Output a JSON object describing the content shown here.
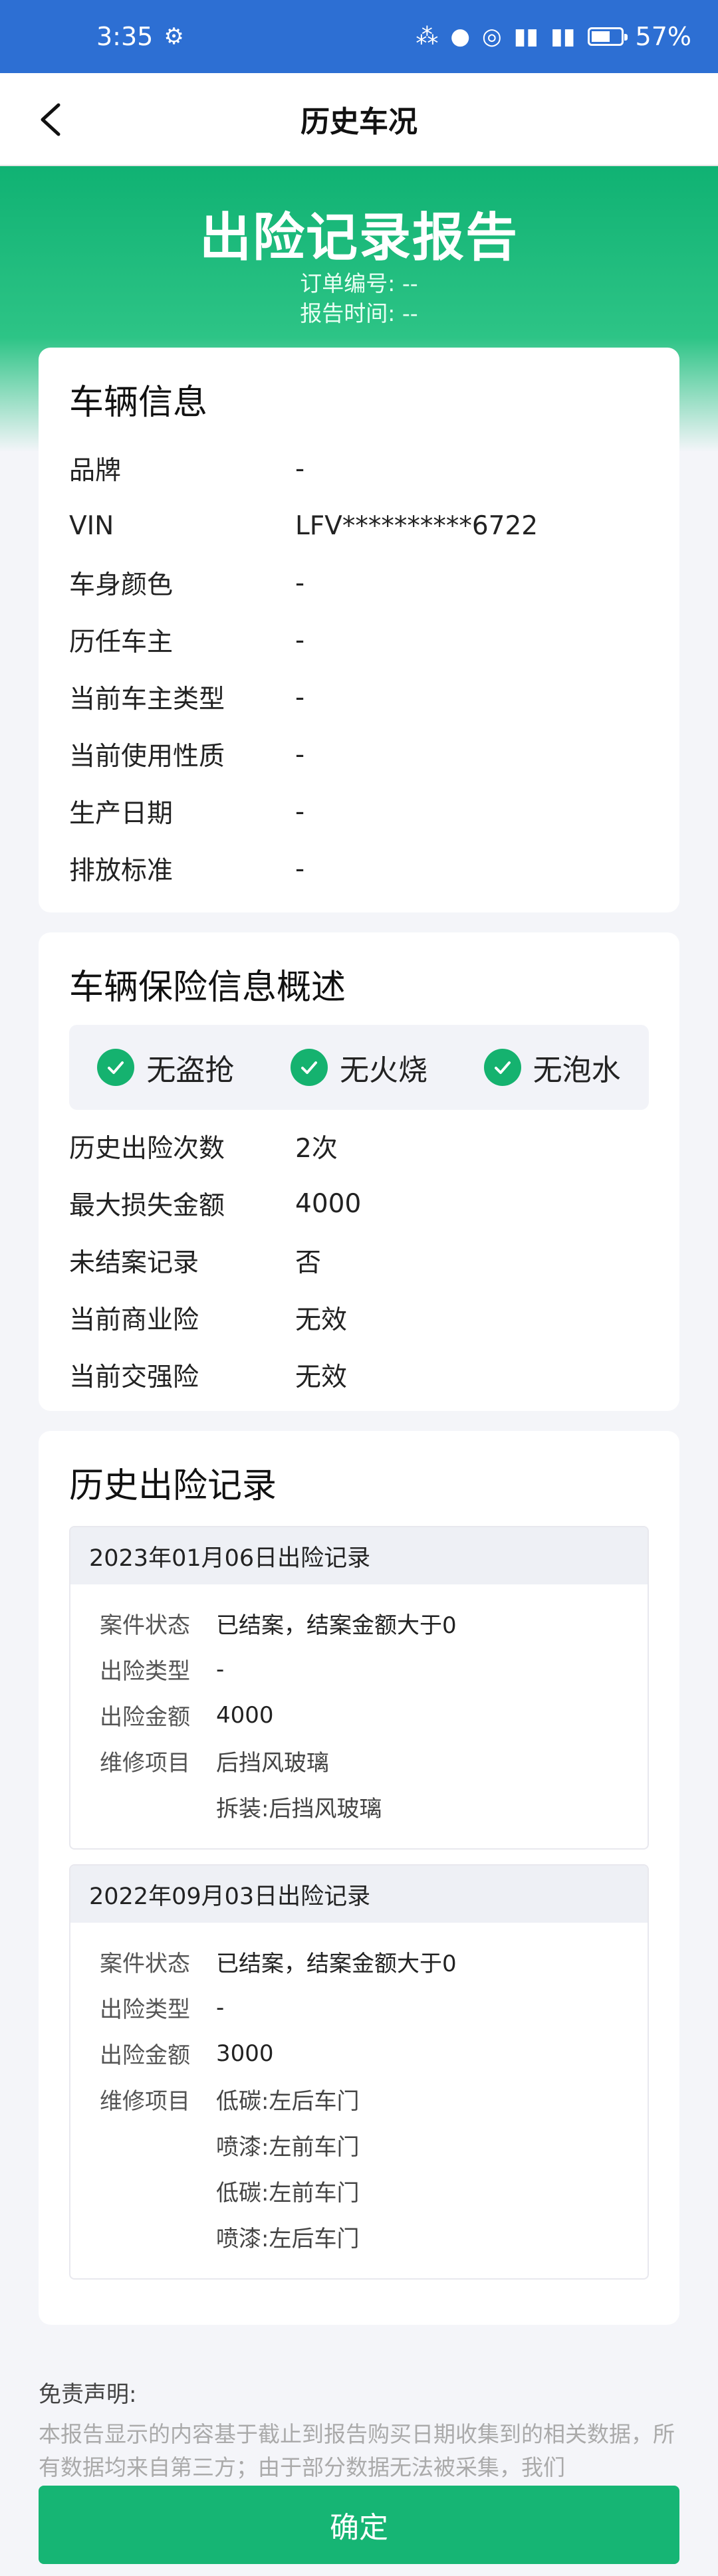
{
  "status_bar": {
    "time": "3:35",
    "battery": "57%"
  },
  "nav": {
    "title": "历史车况"
  },
  "hero": {
    "title": "出险记录报告",
    "order_label": "订单编号:",
    "order_value": "--",
    "report_time_label": "报告时间:",
    "report_time_value": "--"
  },
  "vehicle_info": {
    "title": "车辆信息",
    "rows": [
      {
        "label": "品牌",
        "value": "-"
      },
      {
        "label": "VIN",
        "value": "LFV**********6722"
      },
      {
        "label": "车身颜色",
        "value": "-"
      },
      {
        "label": "历任车主",
        "value": "-"
      },
      {
        "label": "当前车主类型",
        "value": "-"
      },
      {
        "label": "当前使用性质",
        "value": "-"
      },
      {
        "label": "生产日期",
        "value": "-"
      },
      {
        "label": "排放标准",
        "value": "-"
      }
    ]
  },
  "insurance_summary": {
    "title": "车辆保险信息概述",
    "badges": [
      "无盗抢",
      "无火烧",
      "无泡水"
    ],
    "rows": [
      {
        "label": "历史出险次数",
        "value": "2次"
      },
      {
        "label": "最大损失金额",
        "value": "4000"
      },
      {
        "label": "未结案记录",
        "value": "否"
      },
      {
        "label": "当前商业险",
        "value": "无效"
      },
      {
        "label": "当前交强险",
        "value": "无效"
      }
    ]
  },
  "history": {
    "title": "历史出险记录",
    "labels": {
      "status": "案件状态",
      "type": "出险类型",
      "amount": "出险金额",
      "repair": "维修项目"
    },
    "records": [
      {
        "header": "2023年01月06日出险记录",
        "status": "已结案，结案金额大于0",
        "type": "-",
        "amount": "4000",
        "repairs": [
          "后挡风玻璃",
          "拆装:后挡风玻璃"
        ]
      },
      {
        "header": "2022年09月03日出险记录",
        "status": "已结案，结案金额大于0",
        "type": "-",
        "amount": "3000",
        "repairs": [
          "低碳:左后车门",
          "喷漆:左前车门",
          "低碳:左前车门",
          "喷漆:左后车门"
        ]
      }
    ]
  },
  "disclaimer": {
    "title": "免责声明:",
    "text": "本报告显示的内容基于截止到报告购买日期收集到的相关数据，所有数据均来自第三方；由于部分数据无法被采集，我们"
  },
  "confirm": {
    "label": "确定"
  },
  "colors": {
    "primary_green": "#16b574",
    "status_bar_blue": "#2d6fd3"
  }
}
